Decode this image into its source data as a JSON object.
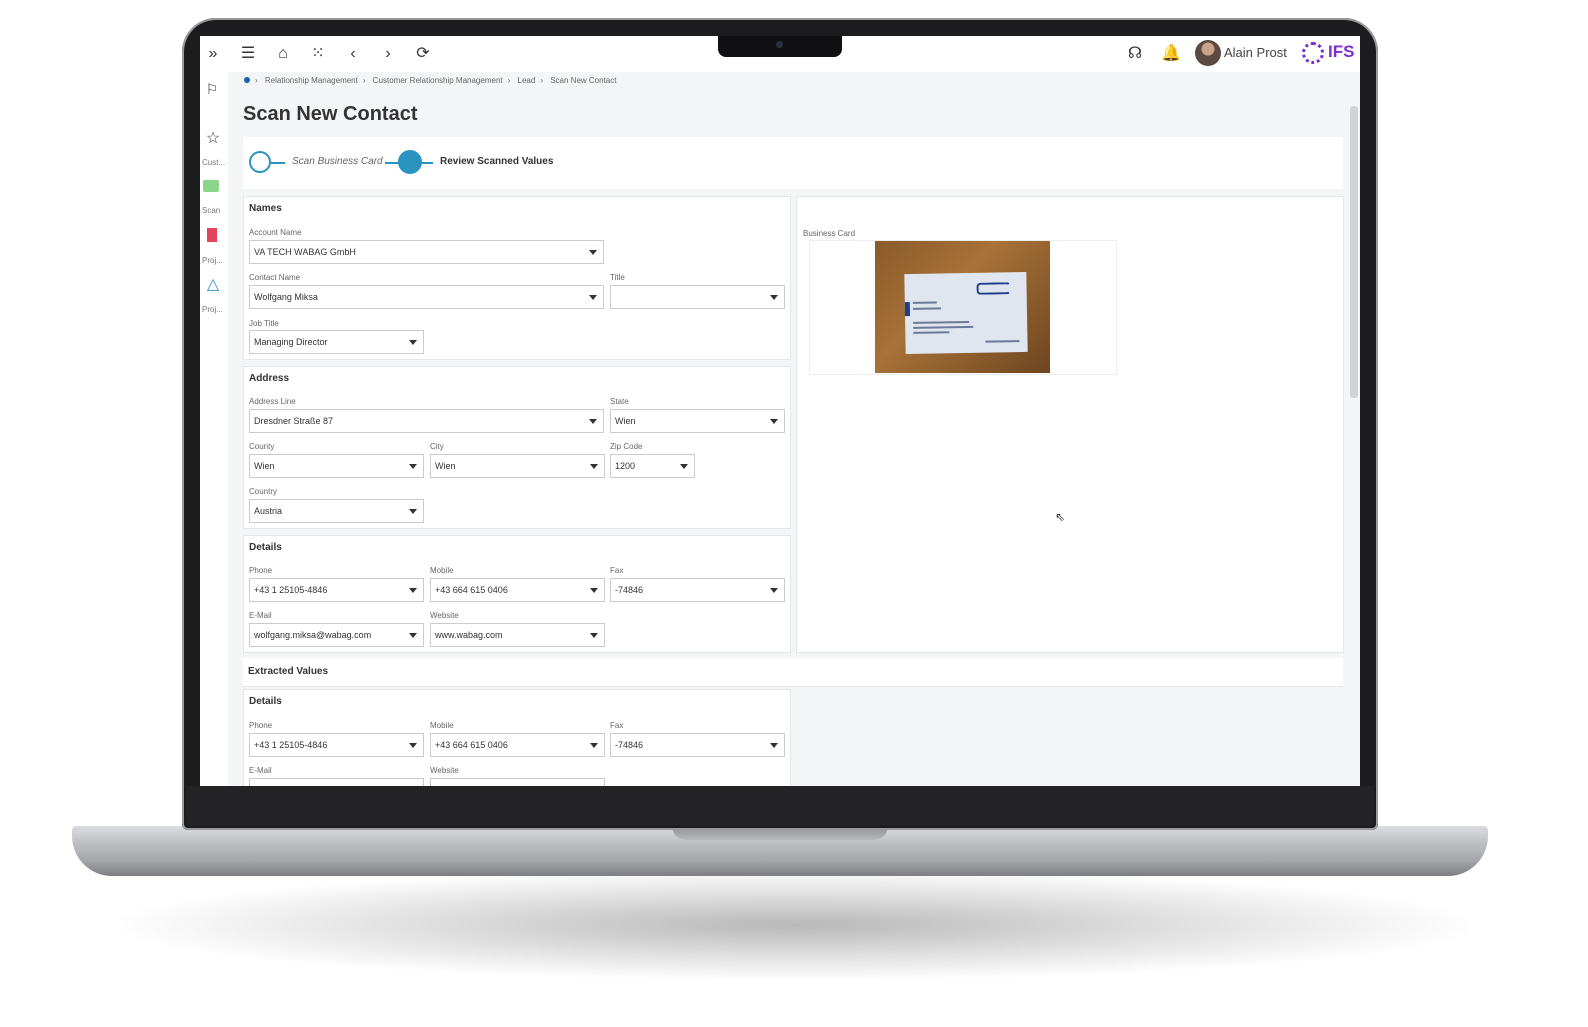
{
  "topbar": {
    "user_name": "Alain Prost",
    "logo_text": "IFS",
    "icons": [
      "expand-icon",
      "menu-icon",
      "home-icon",
      "apps-grid-icon",
      "back-icon",
      "forward-icon",
      "refresh-icon",
      "assistant-icon",
      "bell-icon"
    ]
  },
  "rail": {
    "items": [
      {
        "label": "Cust..."
      },
      {
        "label": "Scan"
      },
      {
        "label": "Proj..."
      },
      {
        "label": "Proj..."
      }
    ]
  },
  "breadcrumb": [
    "Relationship Management",
    "Customer Relationship Management",
    "Lead",
    "Scan New Contact"
  ],
  "page_title": "Scan New Contact",
  "stepper": {
    "step1": "Scan Business Card",
    "step2": "Review Scanned Values"
  },
  "names": {
    "title": "Names",
    "account_name_label": "Account Name",
    "account_name": "VA TECH WABAG GmbH",
    "contact_name_label": "Contact Name",
    "contact_name": "Wolfgang Miksa",
    "title_label": "Title",
    "title_value": "",
    "job_title_label": "Job Title",
    "job_title": "Managing Director"
  },
  "address": {
    "title": "Address",
    "line_label": "Address Line",
    "line": "Dresdner Straße 87",
    "state_label": "State",
    "state": "Wien",
    "county_label": "County",
    "county": "Wien",
    "city_label": "City",
    "city": "Wien",
    "zip_label": "Zip Code",
    "zip": "1200",
    "country_label": "Country",
    "country": "Austria"
  },
  "details": {
    "title": "Details",
    "phone_label": "Phone",
    "phone": "+43 1 25105-4846",
    "mobile_label": "Mobile",
    "mobile": "+43 664 615 0406",
    "fax_label": "Fax",
    "fax": "-74846",
    "email_label": "E-Mail",
    "email": "wolfgang.miksa@wabag.com",
    "website_label": "Website",
    "website": "www.wabag.com"
  },
  "business_card": {
    "label": "Business Card"
  },
  "extracted": {
    "title": "Extracted Values",
    "details_title": "Details",
    "phone_label": "Phone",
    "phone": "+43 1 25105-4846",
    "mobile_label": "Mobile",
    "mobile": "+43 664 615 0406",
    "fax_label": "Fax",
    "fax": "-74846",
    "email_label": "E-Mail",
    "website_label": "Website"
  }
}
